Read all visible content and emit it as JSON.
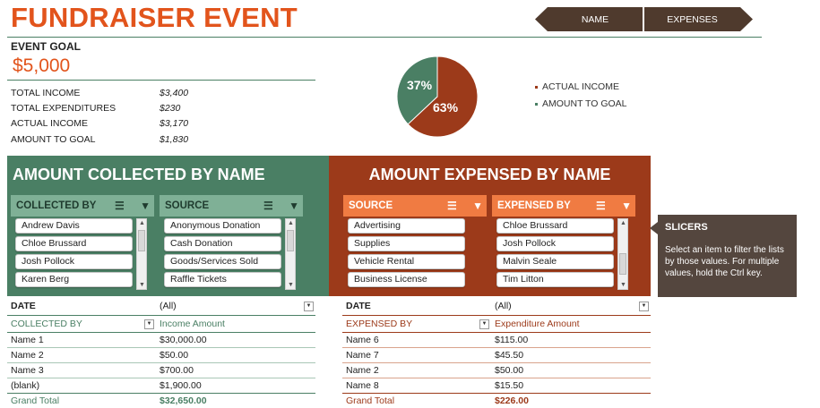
{
  "header": {
    "title": "FUNDRAISER EVENT"
  },
  "nav": {
    "name_label": "NAME",
    "expenses_label": "EXPENSES"
  },
  "summary": {
    "goal_label": "EVENT GOAL",
    "goal_value": "$5,000",
    "rows": [
      {
        "label": "TOTAL INCOME",
        "value": "$3,400"
      },
      {
        "label": "TOTAL EXPENDITURES",
        "value": "$230"
      },
      {
        "label": "ACTUAL INCOME",
        "value": "$3,170"
      },
      {
        "label": "AMOUNT TO GOAL",
        "value": "$1,830"
      }
    ]
  },
  "chart": {
    "type": "pie",
    "slices": [
      {
        "name": "ACTUAL INCOME",
        "percent": 63,
        "label": "63%",
        "color": "#9c3a1a"
      },
      {
        "name": "AMOUNT TO GOAL",
        "percent": 37,
        "label": "37%",
        "color": "#4a7f64"
      }
    ]
  },
  "collected_panel": {
    "title": "AMOUNT COLLECTED BY NAME",
    "slicers": [
      {
        "header": "COLLECTED BY",
        "items": [
          "Andrew Davis",
          "Chloe Brussard",
          "Josh Pollock",
          "Karen Berg"
        ]
      },
      {
        "header": "SOURCE",
        "items": [
          "Anonymous Donation",
          "Cash Donation",
          "Goods/Services Sold",
          "Raffle Tickets"
        ]
      }
    ]
  },
  "expensed_panel": {
    "title": "AMOUNT EXPENSED BY NAME",
    "slicers": [
      {
        "header": "SOURCE",
        "items": [
          "Advertising",
          "Supplies",
          "Vehicle Rental",
          "Business License"
        ]
      },
      {
        "header": "EXPENSED BY",
        "items": [
          "Chloe Brussard",
          "Josh Pollock",
          "Malvin Seale",
          "Tim Litton"
        ]
      }
    ]
  },
  "slicer_info": {
    "title": "SLICERS",
    "text": "Select an item to filter the lists by those values. For multiple values, hold the Ctrl key."
  },
  "income_pivot": {
    "filter_label": "DATE",
    "filter_value": "(All)",
    "row_header": "COLLECTED BY",
    "value_header": "Income Amount",
    "rows": [
      {
        "name": "Name 1",
        "amount": "$30,000.00"
      },
      {
        "name": "Name 2",
        "amount": "$50.00"
      },
      {
        "name": "Name 3",
        "amount": "$700.00"
      },
      {
        "name": "(blank)",
        "amount": "$1,900.00"
      }
    ],
    "total_label": "Grand Total",
    "total_value": "$32,650.00"
  },
  "expense_pivot": {
    "filter_label": "DATE",
    "filter_value": "(All)",
    "row_header": "EXPENSED BY",
    "value_header": "Expenditure Amount",
    "rows": [
      {
        "name": "Name 6",
        "amount": "$115.00"
      },
      {
        "name": "Name 7",
        "amount": "$45.50"
      },
      {
        "name": "Name 2",
        "amount": "$50.00"
      },
      {
        "name": "Name 8",
        "amount": "$15.50"
      }
    ],
    "total_label": "Grand Total",
    "total_value": "$226.00"
  }
}
